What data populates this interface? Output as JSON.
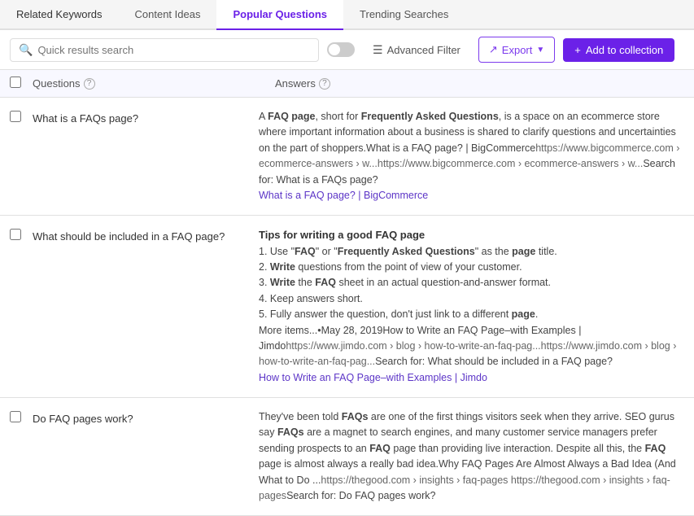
{
  "tabs": [
    {
      "label": "Related Keywords",
      "active": false
    },
    {
      "label": "Content Ideas",
      "active": false
    },
    {
      "label": "Popular Questions",
      "active": true
    },
    {
      "label": "Trending Searches",
      "active": false
    }
  ],
  "toolbar": {
    "search_placeholder": "Quick results search",
    "adv_filter_label": "Advanced Filter",
    "export_label": "Export",
    "add_label": "Add to collection"
  },
  "table": {
    "col_questions": "Questions",
    "col_answers": "Answers",
    "rows": [
      {
        "question": "What is a FAQs page?",
        "answer_title": "",
        "answer_body": "A FAQ page, short for Frequently Asked Questions, is a space on an ecommerce store where important information about a business is shared to clarify questions and uncertainties on the part of shoppers. What is a FAQ page? | BigCommerce https://www.bigcommerce.com › ecommerce-answers › w... https://www.bigcommerce.com › ecommerce-answers › w... Search for: What is a FAQs page?",
        "source_link": "What is a FAQ page? | BigCommerce"
      },
      {
        "question": "What should be included in a FAQ page?",
        "answer_title": "Tips for writing a good FAQ page",
        "answer_body": "1. Use \"FAQ\" or \"Frequently Asked Questions\" as the page title.\n2. Write questions from the point of view of your customer.\n3. Write the FAQ sheet in an actual question-and-answer format.\n4. Keep answers short.\n5. Fully answer the question, don't just link to a different page.\nMore items... • May 28, 2019 How to Write an FAQ Page–with Examples | Jimdo https://www.jimdo.com › blog › how-to-write-an-faq-pag... https://www.jimdo.com › blog › how-to-write-an-faq-pag... Search for: What should be included in a FAQ page?",
        "source_link": "How to Write an FAQ Page–with Examples | Jimdo"
      },
      {
        "question": "Do FAQ pages work?",
        "answer_title": "",
        "answer_body": "They've been told FAQs are one of the first things visitors seek when they arrive. SEO gurus say FAQs are a magnet to search engines, and many customer service managers prefer sending prospects to an FAQ page than providing live interaction. Despite all this, the FAQ page is almost always a really bad idea. Why FAQ Pages Are Almost Always a Bad Idea (And What to Do ... https://thegood.com › insights › faq-pages https://thegood.com › insights › faq-pages Search for: Do FAQ pages work?",
        "source_link": ""
      }
    ]
  }
}
